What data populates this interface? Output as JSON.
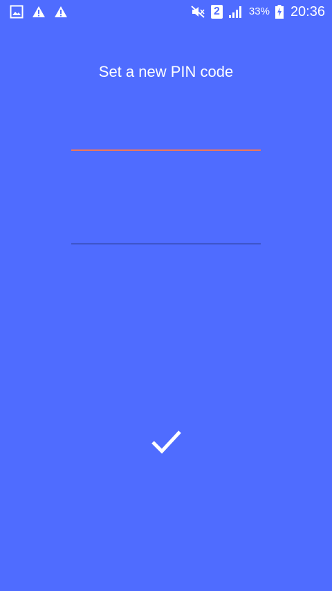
{
  "status_bar": {
    "icons_left": [
      "gallery-icon",
      "warning-icon",
      "warning-icon"
    ],
    "icons_right": [
      "mute-icon",
      "sim-icon",
      "signal-icon",
      "battery-charging-icon"
    ],
    "sim_slot": "2",
    "battery_percent": "33%",
    "time": "20:36"
  },
  "screen": {
    "title": "Set a new PIN code",
    "pin_field": {
      "value": "",
      "placeholder": ""
    },
    "confirm_pin_field": {
      "value": "",
      "placeholder": ""
    },
    "confirm_icon": "check-icon"
  },
  "colors": {
    "background": "#4f6cff",
    "active_underline": "#f0765a",
    "inactive_underline": "#1d2a66",
    "text": "#ffffff"
  }
}
